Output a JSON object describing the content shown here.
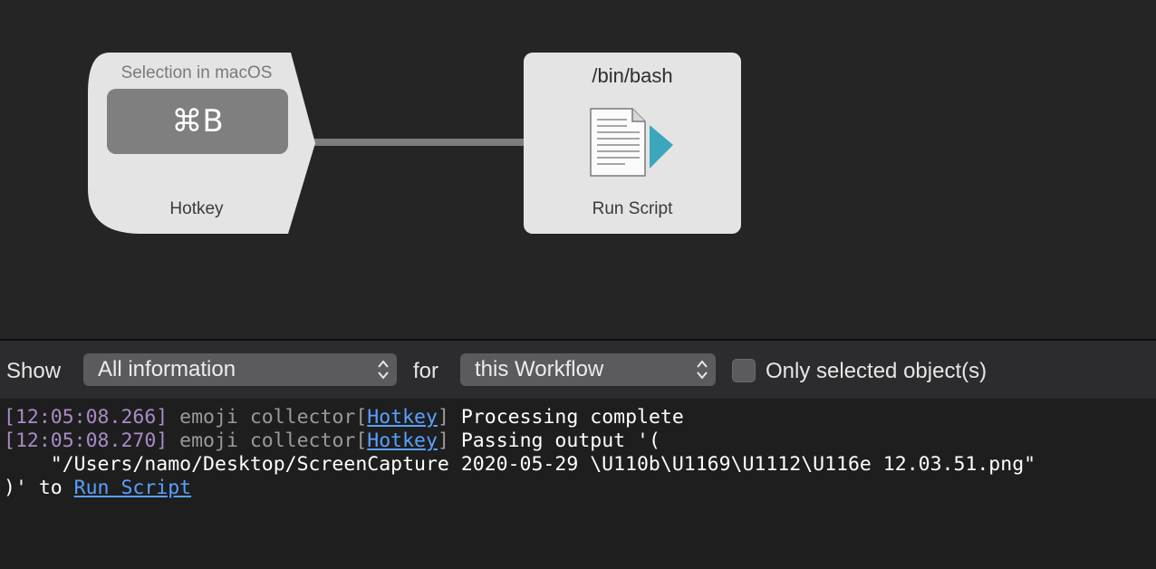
{
  "canvas": {
    "hotkey_node": {
      "title": "Selection in macOS",
      "key": "⌘B",
      "footer": "Hotkey"
    },
    "script_node": {
      "title": "/bin/bash",
      "footer": "Run Script",
      "icon": "script-document-icon"
    }
  },
  "log_toolbar": {
    "show_label": "Show",
    "info_select": "All information",
    "for_label": "for",
    "workflow_select": "this Workflow",
    "only_selected_label": "Only selected object(s)",
    "only_selected_checked": false
  },
  "log": {
    "lines": [
      {
        "timestamp": "[12:05:08.266]",
        "source": "emoji collector[",
        "object": "Hotkey",
        "source_end": "]",
        "message": "Processing complete"
      },
      {
        "timestamp": "[12:05:08.270]",
        "source": "emoji collector[",
        "object": "Hotkey",
        "source_end": "]",
        "message": "Passing output '("
      }
    ],
    "continuation": "    \"/Users/namo/Desktop/ScreenCapture 2020-05-29 \\U110b\\U1169\\U1112\\U116e 12.03.51.png\"",
    "final_prefix": ")' to ",
    "final_link": "Run Script"
  },
  "colors": {
    "timestamp": "#a88bc8",
    "link": "#5aa0ff",
    "node_bg": "#e4e4e4",
    "script_arrow": "#3aa7bd"
  }
}
